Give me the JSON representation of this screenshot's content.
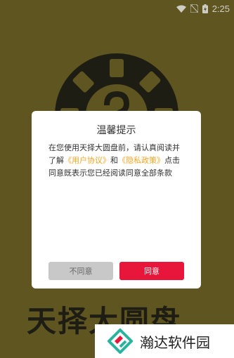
{
  "status_bar": {
    "time": "2:25"
  },
  "background": {
    "title": "天择大圆盘"
  },
  "dialog": {
    "title": "温馨提示",
    "body_prefix": "在您使用天择大圆盘前，请认真阅读并了解",
    "user_agreement_link": "《用户协议》",
    "connector": "和",
    "privacy_policy_link": "《隐私政策》",
    "body_suffix": "点击同意既表示您已经阅读同意全部条款",
    "disagree_label": "不同意",
    "agree_label": "同意"
  },
  "watermark": {
    "text": "瀚达软件园"
  },
  "colors": {
    "background": "#6b5f24",
    "link": "#f5a623",
    "agree_button": "#e8163a",
    "disagree_button": "#c8c8c8"
  }
}
